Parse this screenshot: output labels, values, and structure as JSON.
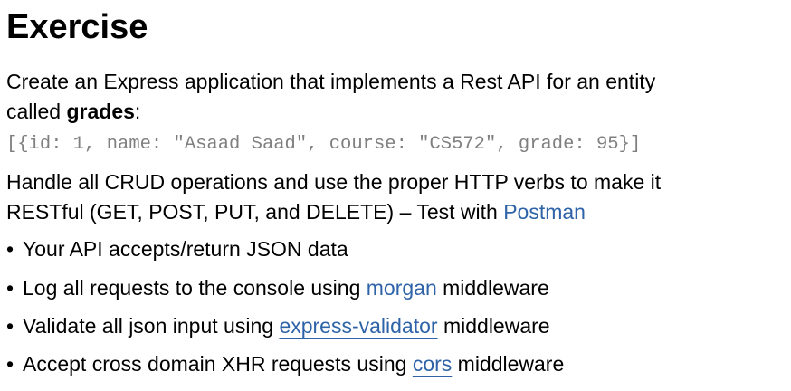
{
  "title": "Exercise",
  "intro": {
    "line1": "Create an Express application that implements a Rest API for an entity",
    "line2_prefix": "called ",
    "entity": "grades",
    "line2_suffix": ":"
  },
  "code_sample": "[{id: 1, name: \"Asaad Saad\", course: \"CS572\", grade: 95}]",
  "crud": {
    "line1": "Handle all CRUD operations and use the proper HTTP verbs to make it",
    "line2_prefix": "RESTful (GET, POST, PUT, and DELETE) – Test with ",
    "link": "Postman"
  },
  "bullets": {
    "symbol": "•",
    "b1_text": "Your API accepts/return JSON data",
    "b2_prefix": "Log all requests to the console using ",
    "b2_link": "morgan",
    "b2_suffix": " middleware",
    "b3_prefix": "Validate all json input using ",
    "b3_link": "express-validator",
    "b3_suffix": " middleware",
    "b4_prefix": "Accept cross domain XHR requests using ",
    "b4_link": "cors",
    "b4_suffix": " middleware"
  },
  "colors": {
    "link": "#2e63a8",
    "code": "#7f7f7f",
    "text": "#000000"
  }
}
